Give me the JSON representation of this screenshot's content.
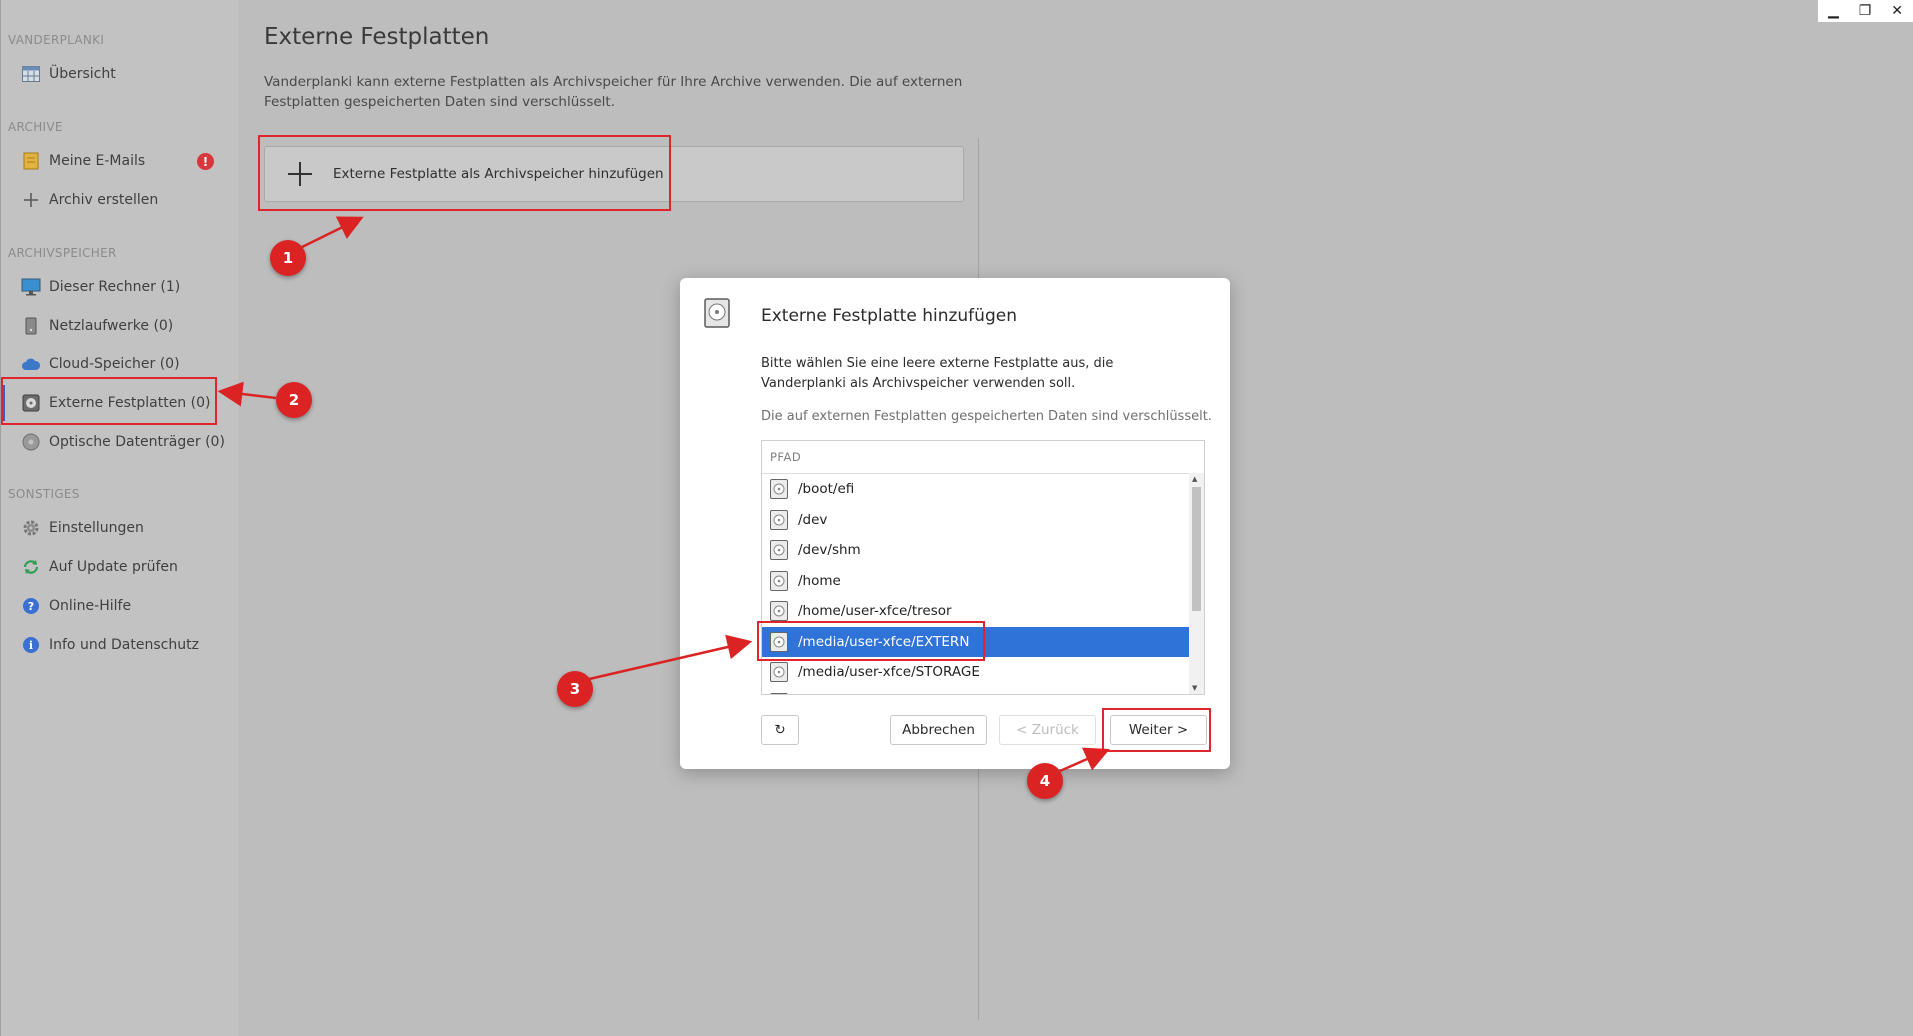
{
  "sidebar": {
    "sections": [
      {
        "title": "VANDERPLANKI",
        "items": [
          {
            "label": "Übersicht",
            "icon": "calendar-icon"
          }
        ]
      },
      {
        "title": "ARCHIVE",
        "items": [
          {
            "label": "Meine E-Mails",
            "icon": "archive-icon",
            "badge": "!"
          },
          {
            "label": "Archiv erstellen",
            "icon": "plus-icon"
          }
        ]
      },
      {
        "title": "ARCHIVSPEICHER",
        "items": [
          {
            "label": "Dieser Rechner (1)",
            "icon": "monitor-icon"
          },
          {
            "label": "Netzlaufwerke (0)",
            "icon": "nas-icon"
          },
          {
            "label": "Cloud-Speicher (0)",
            "icon": "cloud-icon"
          },
          {
            "label": "Externe Festplatten (0)",
            "icon": "harddisk-icon",
            "active": true
          },
          {
            "label": "Optische Datenträger (0)",
            "icon": "disc-icon"
          }
        ]
      },
      {
        "title": "SONSTIGES",
        "items": [
          {
            "label": "Einstellungen",
            "icon": "gear-icon"
          },
          {
            "label": "Auf Update prüfen",
            "icon": "refresh-icon"
          },
          {
            "label": "Online-Hilfe",
            "icon": "help-icon"
          },
          {
            "label": "Info und Datenschutz",
            "icon": "info-icon"
          }
        ]
      }
    ]
  },
  "main": {
    "title": "Externe Festplatten",
    "description": "Vanderplanki kann externe Festplatten als Archivspeicher für Ihre Archive verwenden. Die auf externen Festplatten gespeicherten Daten sind verschlüsselt.",
    "add_button_label": "Externe Festplatte als Archivspeicher hinzufügen"
  },
  "window_controls": {
    "minimize": "▁",
    "restore": "❐",
    "close": "✕"
  },
  "dialog": {
    "title": "Externe Festplatte hinzufügen",
    "text": "Bitte wählen Sie eine leere externe Festplatte aus, die Vanderplanki als Archivspeicher verwenden soll.",
    "note": "Die auf externen Festplatten gespeicherten Daten sind verschlüsselt.",
    "column_header": "PFAD",
    "paths": [
      "/boot/efi",
      "/dev",
      "/dev/shm",
      "/home",
      "/home/user-xfce/tresor",
      "/media/user-xfce/EXTERN",
      "/media/user-xfce/STORAGE",
      ""
    ],
    "selected_path": "/media/user-xfce/EXTERN",
    "buttons": {
      "refresh_icon": "↻",
      "cancel": "Abbrechen",
      "back": "< Zurück",
      "next": "Weiter >"
    }
  },
  "annotations": {
    "steps": [
      "1",
      "2",
      "3",
      "4"
    ],
    "color": "#dc2323"
  },
  "colors": {
    "accent": "#2f73d9",
    "badge": "#d9363e",
    "highlight": "#e0262b"
  }
}
